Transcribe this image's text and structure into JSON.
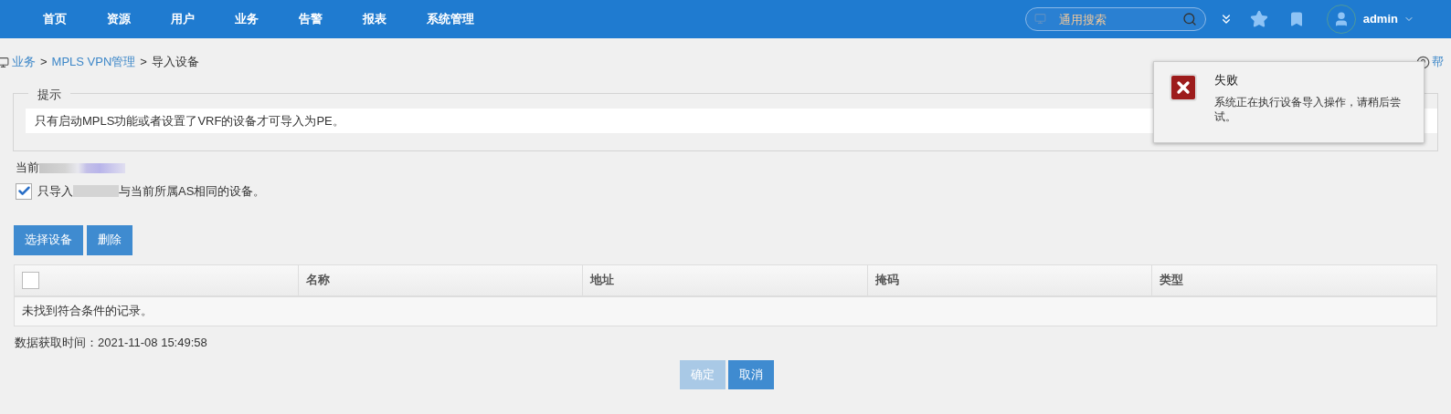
{
  "nav": {
    "items": [
      "首页",
      "资源",
      "用户",
      "业务",
      "告警",
      "报表",
      "系统管理"
    ],
    "search_placeholder": "通用搜索",
    "user": "admin"
  },
  "breadcrumb": {
    "separator": ">",
    "items": [
      {
        "label": "业务",
        "link": true
      },
      {
        "label": "MPLS VPN管理",
        "link": true
      },
      {
        "label": "导入设备",
        "link": false
      }
    ],
    "help": "帮"
  },
  "hint": {
    "legend": "提示",
    "text": "只有启动MPLS功能或者设置了VRF的设备才可导入为PE。"
  },
  "current_label": "当前",
  "same_as": {
    "checked": true,
    "label_start": "只导入",
    "label_end": "与当前所属AS相同的设备。"
  },
  "buttons": [
    "选择设备",
    "删除"
  ],
  "table": {
    "select_all_checked": false,
    "columns": [
      "名称",
      "地址",
      "掩码",
      "类型"
    ],
    "empty": "未找到符合条件的记录。"
  },
  "timestamp": "数据获取时间：2021-11-08 15:49:58",
  "footer_buttons": [
    {
      "label": "确定",
      "disabled": true
    },
    {
      "label": "取消",
      "disabled": false
    }
  ],
  "toast": {
    "title": "失败",
    "message": "系统正在执行设备导入操作，请稍后尝试。"
  }
}
